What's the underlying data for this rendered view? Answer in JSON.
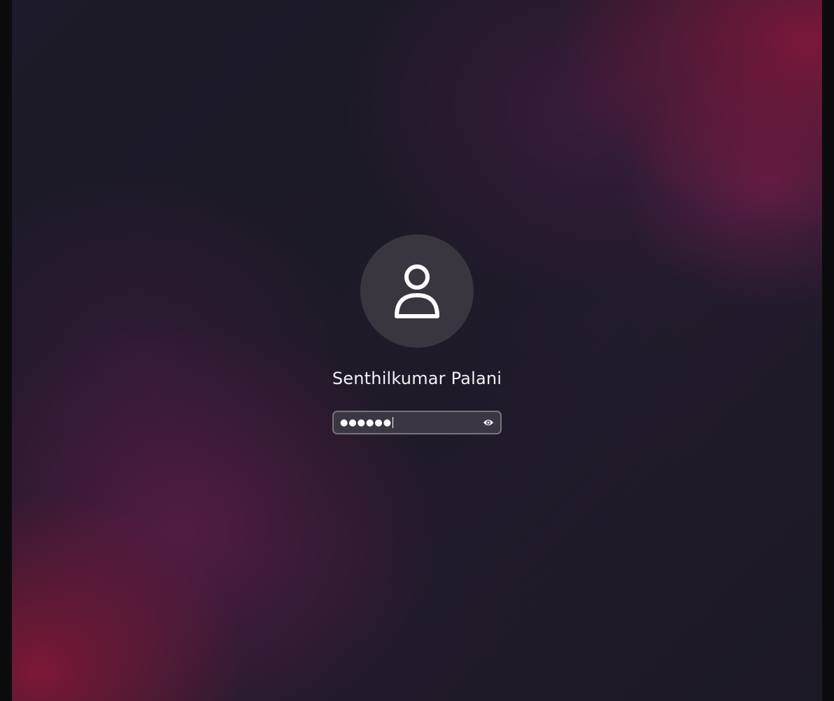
{
  "login": {
    "user": {
      "name": "Senthilkumar Palani",
      "avatar_icon": "user-icon"
    },
    "password": {
      "masked_value": "●●●●●●",
      "reveal_icon": "eye-icon"
    }
  },
  "colors": {
    "accent_red": "#80183c",
    "background_dark": "#1c1926",
    "avatar_bg": "#3a3640",
    "field_bg": "#3b3742",
    "field_border": "#77737f"
  }
}
